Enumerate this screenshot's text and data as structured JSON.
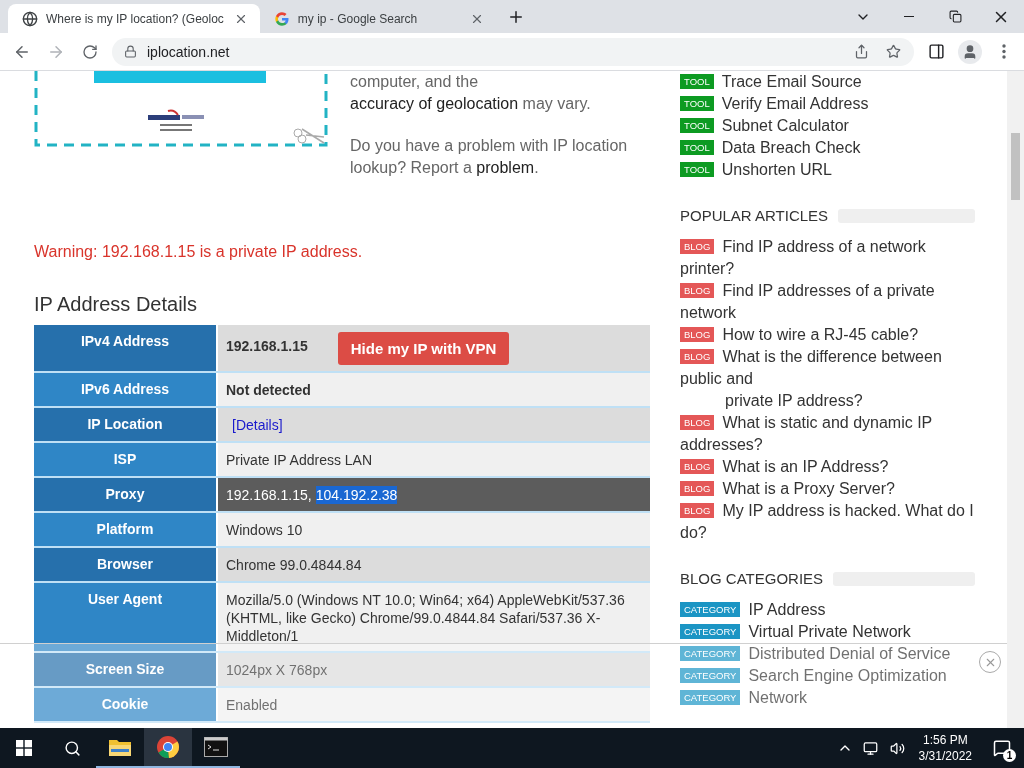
{
  "browser": {
    "tabs": [
      {
        "title": "Where is my IP location? (Geoloc",
        "selected": true
      },
      {
        "title": "my ip - Google Search",
        "selected": false
      }
    ],
    "url": "iplocation.net",
    "forward_disabled": true
  },
  "intro": {
    "paragraphs": [
      {
        "before": "computer, and the",
        "link": "accuracy of geolocation",
        "after": "may vary."
      },
      {
        "before": "Do you have a problem with IP location lookup? Report a",
        "link": "problem",
        "after": "."
      }
    ]
  },
  "warning": "Warning: 192.168.1.15 is a private IP address.",
  "details": {
    "heading": "IP Address Details",
    "rows": [
      {
        "label": "IPv4 Address",
        "value": "192.168.1.15",
        "kind": "bold",
        "button": "Hide my IP with VPN",
        "highlighted": false
      },
      {
        "label": "IPv6 Address",
        "value": "Not detected",
        "kind": "bold",
        "highlighted": false
      },
      {
        "label": "IP Location",
        "value": "[Details]",
        "kind": "link",
        "highlighted": false
      },
      {
        "label": "ISP",
        "value": "Private IP Address LAN",
        "kind": "text",
        "highlighted": false
      },
      {
        "label": "Proxy",
        "value": "192.168.1.15,",
        "selection": "104.192.2.38",
        "kind": "text",
        "highlighted": true
      },
      {
        "label": "Platform",
        "value": "Windows 10",
        "kind": "text",
        "highlighted": false
      },
      {
        "label": "Browser",
        "value": "Chrome 99.0.4844.84",
        "kind": "text",
        "highlighted": false
      },
      {
        "label": "User Agent",
        "value": "Mozilla/5.0 (Windows NT 10.0; Win64; x64) AppleWebKit/537.36 (KHTML, like Gecko) Chrome/99.0.4844.84 Safari/537.36 X-Middleton/1",
        "kind": "text",
        "highlighted": false
      },
      {
        "label": "Screen Size",
        "value": "1024px X 768px",
        "kind": "text",
        "highlighted": false
      },
      {
        "label": "Cookie",
        "value": "Enabled",
        "kind": "text",
        "highlighted": false
      }
    ]
  },
  "sidebar": {
    "sections": [
      {
        "items": [
          {
            "badge": "TOOL",
            "kind": "tool",
            "text": "Trace Email Source"
          },
          {
            "badge": "TOOL",
            "kind": "tool",
            "text": "Verify Email Address"
          },
          {
            "badge": "TOOL",
            "kind": "tool",
            "text": "Subnet Calculator"
          },
          {
            "badge": "TOOL",
            "kind": "tool",
            "text": "Data Breach Check"
          },
          {
            "badge": "TOOL",
            "kind": "tool",
            "text": "Unshorten URL"
          }
        ]
      },
      {
        "heading": "POPULAR ARTICLES",
        "items": [
          {
            "badge": "BLOG",
            "kind": "blog",
            "text": "Find IP address of a network printer?"
          },
          {
            "badge": "BLOG",
            "kind": "blog",
            "text": "Find IP addresses of a private network"
          },
          {
            "badge": "BLOG",
            "kind": "blog",
            "text": "How to wire a RJ-45 cable?"
          },
          {
            "badge": "BLOG",
            "kind": "blog",
            "text": "What is the difference between public and",
            "continuation": "private IP address?"
          },
          {
            "badge": "BLOG",
            "kind": "blog",
            "text": "What is static and dynamic IP addresses?"
          },
          {
            "badge": "BLOG",
            "kind": "blog",
            "text": "What is an IP Address?"
          },
          {
            "badge": "BLOG",
            "kind": "blog",
            "text": "What is a Proxy Server?"
          },
          {
            "badge": "BLOG",
            "kind": "blog",
            "text": "My IP address is hacked. What do I do?"
          }
        ]
      },
      {
        "heading": "BLOG CATEGORIES",
        "items": [
          {
            "badge": "CATEGORY",
            "kind": "category",
            "text": "IP Address"
          },
          {
            "badge": "CATEGORY",
            "kind": "category",
            "text": "Virtual Private Network"
          },
          {
            "badge": "CATEGORY",
            "kind": "category",
            "text": "Distributed Denial of Service"
          },
          {
            "badge": "CATEGORY",
            "kind": "category",
            "text": "Search Engine Optimization"
          },
          {
            "badge": "CATEGORY",
            "kind": "category",
            "text": "Network"
          }
        ]
      }
    ]
  },
  "taskbar": {
    "apps": [
      {
        "kind": "explorer",
        "selected": false
      },
      {
        "kind": "chrome",
        "selected": true
      },
      {
        "kind": "terminal",
        "selected": false
      }
    ],
    "time": "1:56 PM",
    "date": "3/31/2022",
    "notifications": "1"
  }
}
